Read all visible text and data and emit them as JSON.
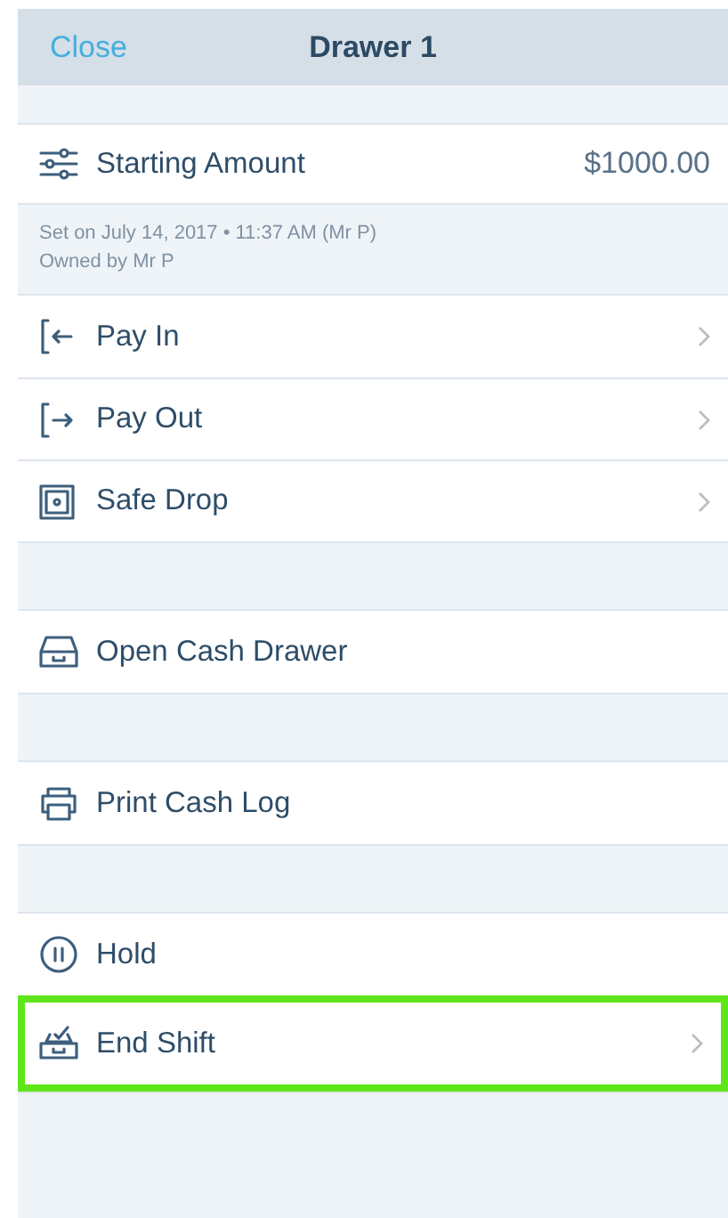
{
  "header": {
    "close": "Close",
    "title": "Drawer 1"
  },
  "starting_amount": {
    "label": "Starting Amount",
    "value": "$1000.00"
  },
  "info": [
    "Set on July 14, 2017 • 11:37 AM (Mr P)",
    "Owned by Mr P"
  ],
  "groups": [
    [
      {
        "kind": "pay-in",
        "label": "Pay In",
        "chevron": true,
        "highlighted": false
      },
      {
        "kind": "pay-out",
        "label": "Pay Out",
        "chevron": true,
        "highlighted": false
      },
      {
        "kind": "safe",
        "label": "Safe Drop",
        "chevron": true,
        "highlighted": false
      }
    ],
    [
      {
        "kind": "drawer",
        "label": "Open Cash Drawer",
        "chevron": false,
        "highlighted": false
      }
    ],
    [
      {
        "kind": "printer",
        "label": "Print Cash Log",
        "chevron": false,
        "highlighted": false
      }
    ],
    [
      {
        "kind": "pause",
        "label": "Hold",
        "chevron": false,
        "highlighted": false
      },
      {
        "kind": "end-shift",
        "label": "End Shift",
        "chevron": true,
        "highlighted": true
      }
    ]
  ]
}
